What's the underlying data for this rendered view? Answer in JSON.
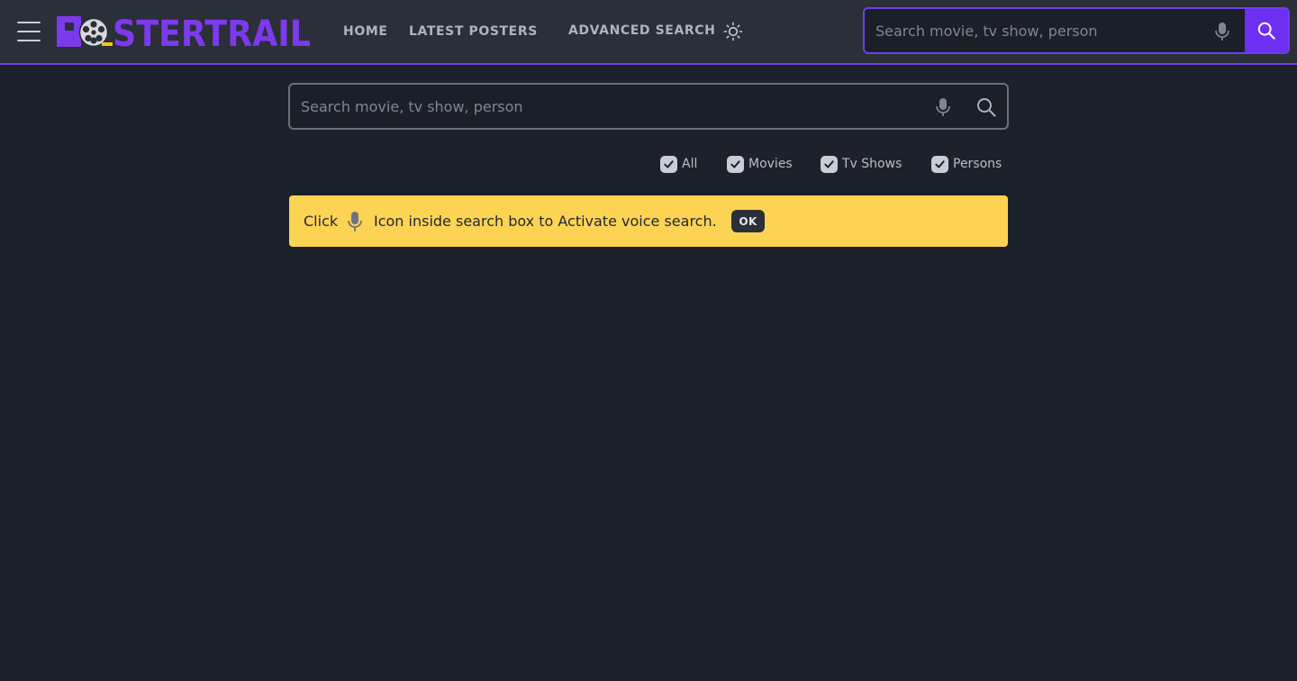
{
  "header": {
    "logo_text": "POSTERTRAIL",
    "nav": {
      "home": "HOME",
      "latest_posters": "LATEST POSTERS",
      "advanced_search": "ADVANCED SEARCH"
    },
    "search": {
      "placeholder": "Search movie, tv show, person",
      "value": ""
    }
  },
  "main": {
    "search": {
      "placeholder": "Search movie, tv show, person",
      "value": ""
    },
    "filters": [
      {
        "label": "All",
        "checked": true
      },
      {
        "label": "Movies",
        "checked": true
      },
      {
        "label": "Tv Shows",
        "checked": true
      },
      {
        "label": "Persons",
        "checked": true
      }
    ],
    "alert": {
      "text_before_icon": "Click",
      "text_after_icon": "Icon inside search box to Activate voice search.",
      "ok_label": "OK"
    }
  },
  "colors": {
    "background": "#1d2129",
    "header_bg": "#2a2f38",
    "accent": "#6d2ff2",
    "alert_bg": "#fdd353"
  },
  "icons": [
    "menu-icon",
    "film-reel-icon",
    "sun-icon",
    "microphone-icon",
    "search-icon",
    "checkmark-icon"
  ]
}
